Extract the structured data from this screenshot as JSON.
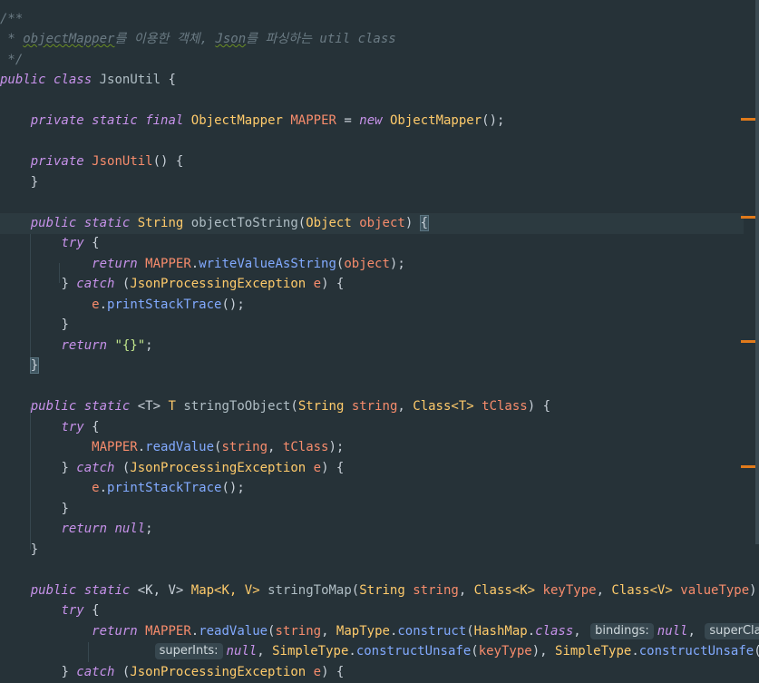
{
  "editor": {
    "doc_comment": {
      "open": "/**",
      "text_prefix": " * ",
      "object_mapper": "objectMapper",
      "korean1": "를 이용한 객체, ",
      "json_word": "Json",
      "korean2": "를 파싱하는 util class",
      "close": " */"
    },
    "kw_public": "public",
    "kw_private": "private",
    "kw_static": "static",
    "kw_final": "final",
    "kw_class": "class",
    "kw_new": "new",
    "kw_try": "try",
    "kw_catch": "catch",
    "kw_return": "return",
    "kw_null": "null",
    "class_name": "JsonUtil",
    "object_mapper_type": "ObjectMapper",
    "mapper_field": "MAPPER",
    "string_type": "String",
    "object_type": "Object",
    "json_exception": "JsonProcessingException",
    "method_to_string": "objectToString",
    "method_to_object": "stringToObject",
    "method_to_map": "stringToMap",
    "write_value": "writeValueAsString",
    "read_value": "readValue",
    "print_trace": "printStackTrace",
    "param_object": "object",
    "param_string": "string",
    "param_tclass": "tClass",
    "param_e": "e",
    "param_key_type": "keyType",
    "param_value_type": "valueType",
    "empty_json": "\"{}\"",
    "map_type": "MapType",
    "construct": "construct",
    "hash_map": "HashMap",
    "simple_type": "SimpleType",
    "construct_unsafe": "constructUnsafe",
    "map_generic": "Map<K, V>",
    "class_k": "Class<K>",
    "class_v": "Class<V>",
    "class_t": "Class<T>",
    "generic_t": "<T>",
    "generic_kv": "<K, V>",
    "type_t": "T",
    "inlay_hints": {
      "bindings": "bindings:",
      "super_class": "superClass:",
      "super_ints": "superInts:"
    },
    "truncated_tail": "valu"
  },
  "colors": {
    "background": "#263238",
    "keyword": "#c792ea",
    "type": "#ffcb6b",
    "field": "#f78c6c",
    "method_call": "#82aaff",
    "string": "#c3e88d",
    "comment": "#6b7b84",
    "scroll_marker": "#e07a1b"
  }
}
